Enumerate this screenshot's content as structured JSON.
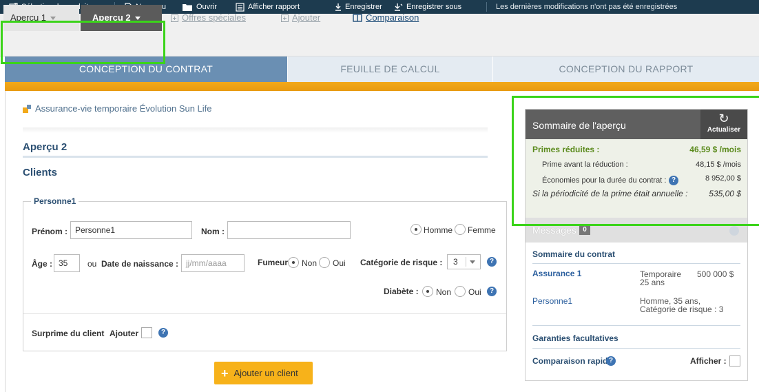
{
  "toolbar": {
    "product_select": "Sélection de produit",
    "new": "Nouveau",
    "open": "Ouvrir",
    "show_report": "Afficher rapport",
    "save": "Enregistrer",
    "save_as": "Enregistrer sous",
    "notice": "Les dernières modifications n'ont pas été enregistrées"
  },
  "tabs": {
    "apercu1": "Aperçu 1",
    "apercu2": "Aperçu 2",
    "offres": "Offres spéciales",
    "ajouter": "Ajouter",
    "comparaison": "Comparaison"
  },
  "sections": {
    "conception_contrat": "CONCEPTION DU CONTRAT",
    "feuille_calcul": "FEUILLE DE CALCUL",
    "conception_rapport": "CONCEPTION DU RAPPORT"
  },
  "product_title": "Assurance-vie temporaire Évolution Sun Life",
  "apercu_heading": "Aperçu 2",
  "clients_heading": "Clients",
  "person": {
    "legend": "Personne1",
    "prenom_label": "Prénom :",
    "prenom_value": "Personne1",
    "nom_label": "Nom :",
    "nom_value": "",
    "homme": "Homme",
    "femme": "Femme",
    "age_label": "Âge :",
    "age_value": "35",
    "ou": "ou",
    "dob_label": "Date de naissance :",
    "dob_placeholder": "jj/mm/aaaa",
    "fumeur_label": "Fumeur :",
    "non": "Non",
    "oui": "Oui",
    "risque_label": "Catégorie de risque :",
    "risque_value": "3",
    "diabete_label": "Diabète :",
    "diabete_non": "Non",
    "diabete_oui": "Oui",
    "surprime_label": "Surprime du client",
    "surprime_ajouter": "Ajouter"
  },
  "add_client_button": "Ajouter un client",
  "summary": {
    "title": "Sommaire de l'aperçu",
    "refresh": "Actualiser",
    "primes_label": "Primes réduites :",
    "primes_value": "46,59 $ /mois",
    "avant_label": "Prime avant la réduction :",
    "avant_value": "48,15 $ /mois",
    "economies_label": "Économies pour la durée du contrat :",
    "economies_value": "8 952,00 $",
    "annuelle_label": "Si la périodicité de la prime était annuelle :",
    "annuelle_value": "535,00 $"
  },
  "messages": {
    "title": "Messages",
    "count": "0"
  },
  "contract_summary": {
    "title": "Sommaire du contrat",
    "assurance_label": "Assurance 1",
    "assurance_type": "Temporaire",
    "assurance_term": "25 ans",
    "assurance_amount": "500 000 $",
    "person_label": "Personne1",
    "person_line1": "Homme, 35 ans,",
    "person_line2": "Catégorie de risque : 3",
    "garanties": "Garanties facultatives",
    "comparaison": "Comparaison rapide",
    "afficher": "Afficher :"
  }
}
